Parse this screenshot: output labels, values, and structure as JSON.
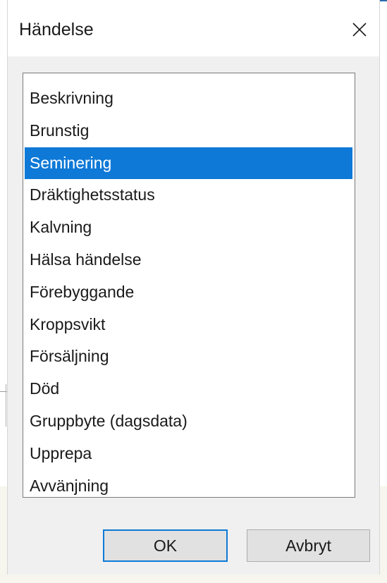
{
  "dialog": {
    "title": "Händelse",
    "close_icon": "close-icon"
  },
  "list": {
    "items": [
      {
        "label": "Beskrivning",
        "selected": false
      },
      {
        "label": "Brunstig",
        "selected": false
      },
      {
        "label": "Seminering",
        "selected": true
      },
      {
        "label": "Dräktighetsstatus",
        "selected": false
      },
      {
        "label": "Kalvning",
        "selected": false
      },
      {
        "label": "Hälsa händelse",
        "selected": false
      },
      {
        "label": "Förebyggande",
        "selected": false
      },
      {
        "label": "Kroppsvikt",
        "selected": false
      },
      {
        "label": "Försäljning",
        "selected": false
      },
      {
        "label": "Död",
        "selected": false
      },
      {
        "label": "Gruppbyte (dagsdata)",
        "selected": false
      },
      {
        "label": "Upprepa",
        "selected": false
      },
      {
        "label": "Avvänjning",
        "selected": false
      }
    ]
  },
  "buttons": {
    "ok_label": "OK",
    "cancel_label": "Avbryt"
  },
  "colors": {
    "selection": "#0e79d7",
    "dialog_body": "#f0f0f0"
  }
}
